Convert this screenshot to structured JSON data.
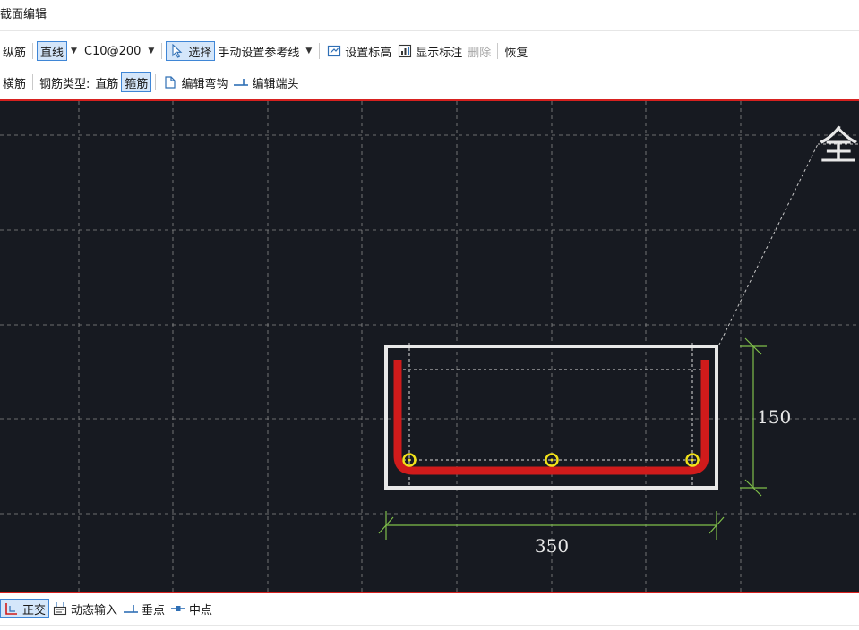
{
  "window": {
    "title": "截面编辑"
  },
  "toolbar1": {
    "longitudinal_rebar": "纵筋",
    "line_mode": "直线",
    "spec_value": "C10@200",
    "select": "选择",
    "manual_reference_line": "手动设置参考线",
    "set_elevation": "设置标高",
    "show_annotation": "显示标注",
    "delete": "删除",
    "restore": "恢复"
  },
  "toolbar2": {
    "transverse_rebar": "横筋",
    "rebar_type_label": "钢筋类型:",
    "straight_rebar": "直筋",
    "stirrup": "箍筋",
    "edit_hook": "编辑弯钩",
    "edit_end": "编辑端头"
  },
  "canvas": {
    "callout_text": "全",
    "width_dimension": "350",
    "height_dimension": "150",
    "colors": {
      "background": "#171a21",
      "grid": "#8a8a8a",
      "section_outline": "#e8e8e8",
      "stirrup": "#d01b1b",
      "rebar_point": "#f2e21a",
      "dimension": "#7fbf4a",
      "border": "#d7211f"
    }
  },
  "statusbar": {
    "ortho": "正交",
    "dynamic_input": "动态输入",
    "perpendicular": "垂点",
    "midpoint": "中点"
  }
}
